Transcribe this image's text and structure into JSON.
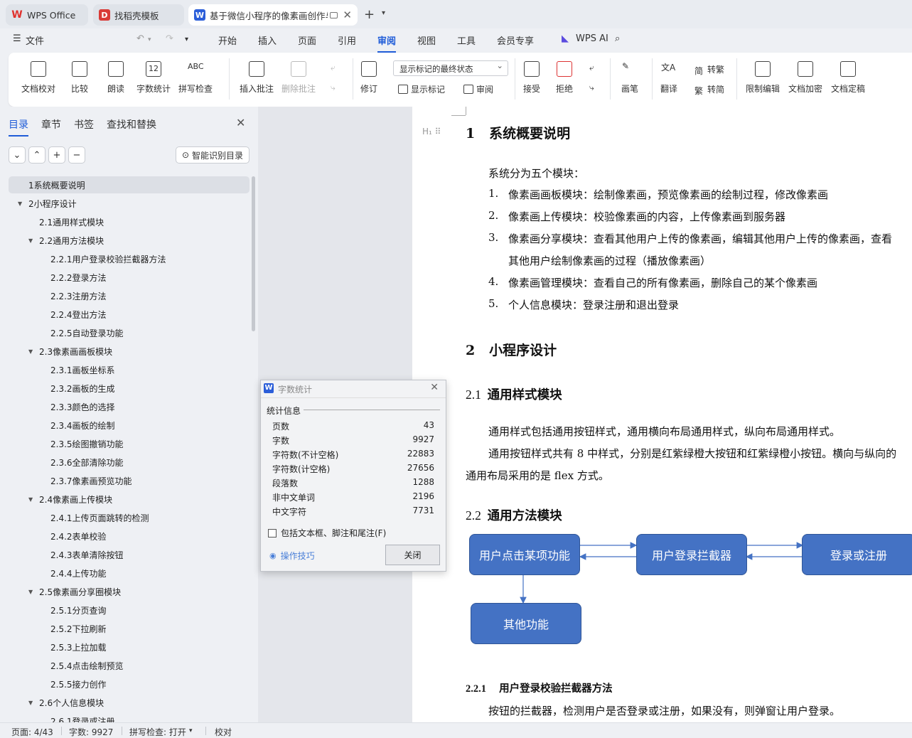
{
  "tabs": [
    {
      "label": "WPS Office",
      "icon": "wps-logo-icon"
    },
    {
      "label": "找稻壳模板",
      "icon": "docer-icon"
    },
    {
      "label": "基于微信小程序的像素画创作与",
      "icon": "word-doc-icon"
    }
  ],
  "menu": {
    "file": "文件",
    "items": [
      "开始",
      "插入",
      "页面",
      "引用",
      "审阅",
      "视图",
      "工具",
      "会员专享"
    ],
    "active": "审阅",
    "ai": "WPS AI"
  },
  "ribbon": {
    "doc_check": "文档校对",
    "compare": "比较",
    "read_aloud": "朗读",
    "word_count": "字数统计",
    "spell_check": "拼写检查",
    "insert_comment": "插入批注",
    "delete_comment": "删除批注",
    "track_changes": "修订",
    "markup_state": "显示标记的最终状态",
    "show_markup": "显示标记",
    "review_pane": "审阅",
    "accept": "接受",
    "reject": "拒绝",
    "pen": "画笔",
    "translate": "翻译",
    "to_traditional": "转繁",
    "to_simplified": "转简",
    "restrict_edit": "限制编辑",
    "encrypt": "文档加密",
    "finalize": "文档定稿",
    "wordcount_icon_text": "12",
    "spell_icon_text": "ABC"
  },
  "nav": {
    "tabs": [
      "目录",
      "章节",
      "书签",
      "查找和替换"
    ],
    "smart_toc": "智能识别目录",
    "toc": [
      {
        "text": "1系统概要说明",
        "level": 1,
        "sel": true,
        "tw": false
      },
      {
        "text": "2小程序设计",
        "level": 1,
        "tw": true
      },
      {
        "text": "2.1通用样式模块",
        "level": 2,
        "tw": false
      },
      {
        "text": "2.2通用方法模块",
        "level": 2,
        "tw": true
      },
      {
        "text": "2.2.1用户登录校验拦截器方法",
        "level": 3
      },
      {
        "text": "2.2.2登录方法",
        "level": 3
      },
      {
        "text": "2.2.3注册方法",
        "level": 3
      },
      {
        "text": "2.2.4登出方法",
        "level": 3
      },
      {
        "text": "2.2.5自动登录功能",
        "level": 3
      },
      {
        "text": "2.3像素画画板模块",
        "level": 2,
        "tw": true
      },
      {
        "text": "2.3.1画板坐标系",
        "level": 3
      },
      {
        "text": "2.3.2画板的生成",
        "level": 3
      },
      {
        "text": "2.3.3颜色的选择",
        "level": 3
      },
      {
        "text": "2.3.4画板的绘制",
        "level": 3
      },
      {
        "text": "2.3.5绘图撤销功能",
        "level": 3
      },
      {
        "text": "2.3.6全部清除功能",
        "level": 3
      },
      {
        "text": "2.3.7像素画预览功能",
        "level": 3
      },
      {
        "text": "2.4像素画上传模块",
        "level": 2,
        "tw": true
      },
      {
        "text": "2.4.1上传页面跳转的检测",
        "level": 3
      },
      {
        "text": "2.4.2表单校验",
        "level": 3
      },
      {
        "text": "2.4.3表单清除按钮",
        "level": 3
      },
      {
        "text": "2.4.4上传功能",
        "level": 3
      },
      {
        "text": "2.5像素画分享圈模块",
        "level": 2,
        "tw": true
      },
      {
        "text": "2.5.1分页查询",
        "level": 3
      },
      {
        "text": "2.5.2下拉刷新",
        "level": 3
      },
      {
        "text": "2.5.3上拉加载",
        "level": 3
      },
      {
        "text": "2.5.4点击绘制预览",
        "level": 3
      },
      {
        "text": "2.5.5接力创作",
        "level": 3
      },
      {
        "text": "2.6个人信息模块",
        "level": 2,
        "tw": true
      },
      {
        "text": "2.6.1登录或注册",
        "level": 3
      }
    ]
  },
  "doc": {
    "h1_num": "1",
    "h1": "系统概要说明",
    "intro": "系统分为五个模块：",
    "list": [
      {
        "n": "1.",
        "t": "像素画画板模块：绘制像素画，预览像素画的绘制过程，修改像素画"
      },
      {
        "n": "2.",
        "t": "像素画上传模块：校验像素画的内容，上传像素画到服务器"
      },
      {
        "n": "3.",
        "t": "像素画分享模块：查看其他用户上传的像素画，编辑其他用户上传的像素画，查看"
      },
      {
        "n": "",
        "t": "其他用户绘制像素画的过程（播放像素画）"
      },
      {
        "n": "4.",
        "t": "像素画管理模块：查看自己的所有像素画，删除自己的某个像素画"
      },
      {
        "n": "5.",
        "t": "个人信息模块：登录注册和退出登录"
      }
    ],
    "h2_num": "2",
    "h2": "小程序设计",
    "h21_num": "2.1",
    "h21": "通用样式模块",
    "p1": "通用样式包括通用按钮样式，通用横向布局通用样式，纵向布局通用样式。",
    "p2": "通用按钮样式共有 8 中样式，分别是红紫绿橙大按钮和红紫绿橙小按钮。横向与纵向的",
    "p3": "通用布局采用的是 flex 方式。",
    "h22_num": "2.2",
    "h22": "通用方法模块",
    "flow": [
      "用户点击某项功能",
      "用户登录拦截器",
      "登录或注册",
      "其他功能"
    ],
    "h221_num": "2.2.1",
    "h221": "用户登录校验拦截器方法",
    "p4": "按钮的拦截器，检测用户是否登录或注册，如果没有，则弹窗让用户登录。"
  },
  "dialog": {
    "title": "字数统计",
    "section": "统计信息",
    "rows": [
      {
        "k": "页数",
        "v": "43"
      },
      {
        "k": "字数",
        "v": "9927"
      },
      {
        "k": "字符数(不计空格)",
        "v": "22883"
      },
      {
        "k": "字符数(计空格)",
        "v": "27656"
      },
      {
        "k": "段落数",
        "v": "1288"
      },
      {
        "k": "非中文单词",
        "v": "2196"
      },
      {
        "k": "中文字符",
        "v": "7731"
      }
    ],
    "checkbox": "包括文本框、脚注和尾注(F)",
    "tips": "操作技巧",
    "close": "关闭"
  },
  "status": {
    "page": "页面: 4/43",
    "words": "字数: 9927",
    "spell": "拼写检查: 打开",
    "proof": "校对"
  }
}
